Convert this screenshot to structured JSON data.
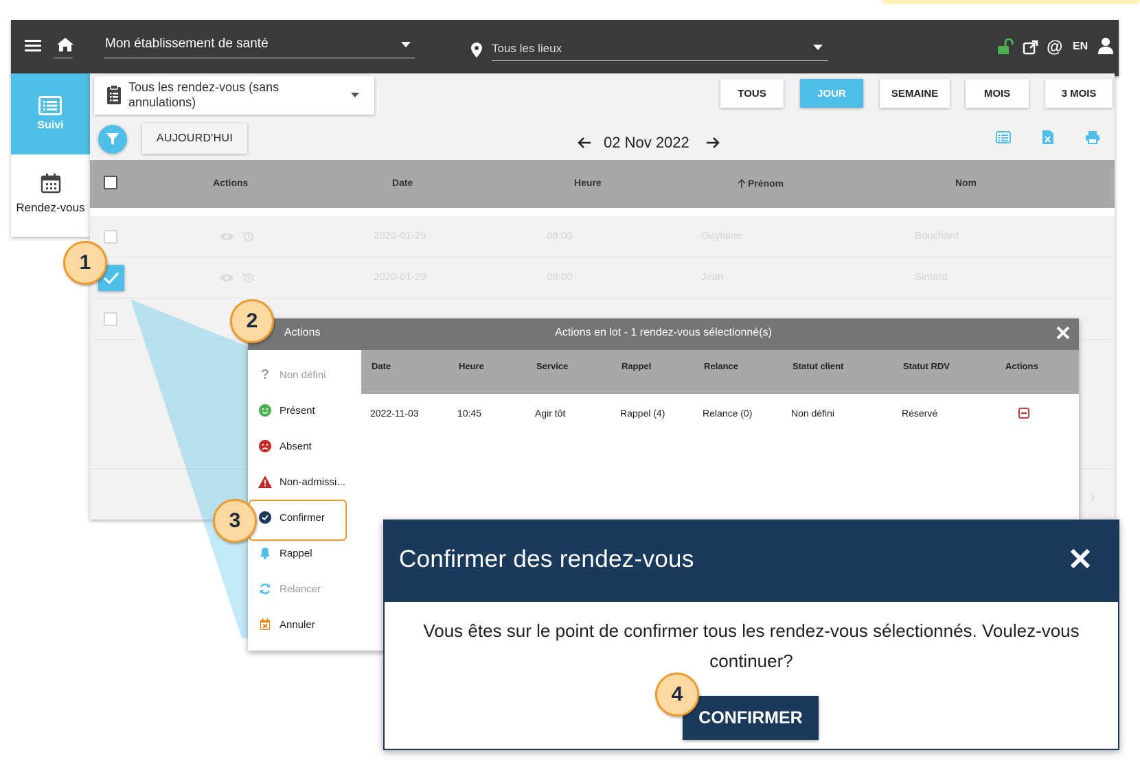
{
  "topbar": {
    "establishment": "Mon établissement de santé",
    "location_placeholder": "Tous les lieux",
    "language": "EN"
  },
  "sidebar": {
    "items": [
      {
        "label": "Suivi",
        "icon": "list-icon",
        "active": true
      },
      {
        "label": "Rendez-vous",
        "icon": "calendar-icon",
        "active": false
      }
    ]
  },
  "filter": {
    "label": "Tous les rendez-vous (sans annulations)"
  },
  "periods": [
    {
      "label": "TOUS",
      "active": false
    },
    {
      "label": "JOUR",
      "active": true
    },
    {
      "label": "SEMAINE",
      "active": false
    },
    {
      "label": "MOIS",
      "active": false
    },
    {
      "label": "3 MOIS",
      "active": false
    }
  ],
  "toolbar": {
    "today_label": "AUJOURD'HUI",
    "date": "02 Nov 2022"
  },
  "table": {
    "headers": [
      "Actions",
      "Date",
      "Heure",
      "Prénom",
      "Nom"
    ],
    "rows": [
      {
        "date": "2020-01-29",
        "time": "08:00",
        "first": "Guylaine",
        "last": "Bouchard",
        "checked": false
      },
      {
        "date": "2020-01-29",
        "time": "08:00",
        "first": "Jean",
        "last": "Simard",
        "checked": true
      }
    ]
  },
  "batch": {
    "left_title": "Actions",
    "title": "Actions en lot - 1 rendez-vous sélectionné(s)",
    "actions": [
      {
        "label": "Non défini",
        "icon": "question-icon",
        "color": "#9e9e9e"
      },
      {
        "label": "Présent",
        "icon": "smile-icon",
        "color": "#4caf50"
      },
      {
        "label": "Absent",
        "icon": "frown-icon",
        "color": "#c62828"
      },
      {
        "label": "Non-admissi...",
        "icon": "warning-icon",
        "color": "#c62828"
      },
      {
        "label": "Confirmer",
        "icon": "check-circle-icon",
        "color": "#1b3a5b"
      },
      {
        "label": "Rappel",
        "icon": "bell-icon",
        "color": "#4fbfe8"
      },
      {
        "label": "Relancer",
        "icon": "refresh-icon",
        "color": "#4fbfe8"
      },
      {
        "label": "Annuler",
        "icon": "calendar-x-icon",
        "color": "#f57c00"
      }
    ],
    "columns": [
      "Date",
      "Heure",
      "Service",
      "Rappel",
      "Relance",
      "Statut client",
      "Statut RDV",
      "Actions"
    ],
    "rows": [
      {
        "date": "2022-11-03",
        "time": "10:45",
        "service": "Agir tôt",
        "rappel": "Rappel (4)",
        "relance": "Relance (0)",
        "client": "Non défini",
        "rdv": "Réservé"
      }
    ]
  },
  "confirm": {
    "title": "Confirmer des rendez-vous",
    "message": "Vous êtes sur le point de confirmer tous les rendez-vous sélectionnés. Voulez-vous continuer?",
    "button": "CONFIRMER"
  },
  "steps": [
    "1",
    "2",
    "3",
    "4"
  ],
  "colors": {
    "accent": "#4fbfe8",
    "topbar": "#3a3a3a",
    "modal": "#1b3a5b",
    "badge": "#fbd9a0",
    "badge_border": "#ed9a2e",
    "unlock": "#4caf50"
  }
}
